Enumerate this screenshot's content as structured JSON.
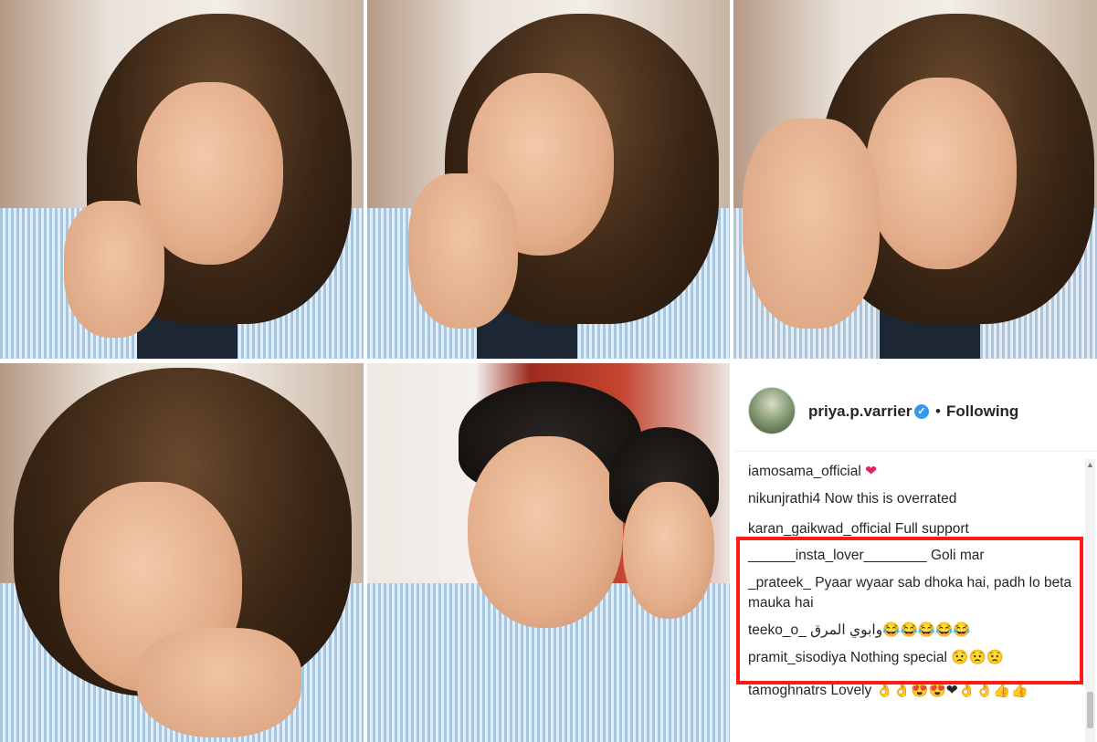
{
  "post": {
    "username": "priya.p.varrier",
    "separator": "•",
    "follow_status": "Following",
    "verified_glyph": "✓"
  },
  "comments": [
    {
      "user": "iamosama_official",
      "text": "",
      "emoji": "❤"
    },
    {
      "user": "nikunjrathi4",
      "text": "Now this is overrated",
      "emoji": ""
    },
    {
      "user": "karan_gaikwad_official",
      "text": "Full support",
      "emoji": ""
    },
    {
      "user": "______insta_lover________",
      "text": "Goli mar",
      "emoji": ""
    },
    {
      "user": "_prateek_",
      "text": "Pyaar wyaar sab dhoka hai, padh lo beta mauka hai",
      "emoji": ""
    },
    {
      "user": "teeko_o_",
      "text": "وابوي المرق",
      "emoji": "😂😂😂😂😂"
    },
    {
      "user": "pramit_sisodiya",
      "text": "Nothing special",
      "emoji": "😟😟😟"
    },
    {
      "user": "tamoghnatrs",
      "text": "Lovely",
      "emoji": "👌👌😍😍❤👌👌👍👍"
    }
  ],
  "colors": {
    "highlight": "#ff1a1a",
    "verified": "#3897f0"
  },
  "icons": {
    "verified": "verified-badge-icon",
    "scroll_up": "chevron-up-icon"
  }
}
